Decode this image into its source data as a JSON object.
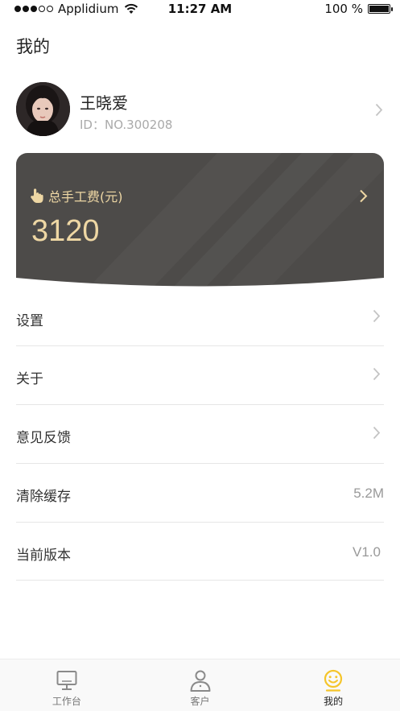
{
  "status_bar": {
    "carrier": "Applidium",
    "time": "11:27 AM",
    "battery": "100 %"
  },
  "page": {
    "title": "我的"
  },
  "profile": {
    "name": "王晓爱",
    "id_text": "ID：NO.300208"
  },
  "fee_card": {
    "label": "总手工费(元)",
    "amount": "3120"
  },
  "menu": {
    "items": [
      {
        "label": "设置"
      },
      {
        "label": "关于"
      },
      {
        "label": "意见反馈"
      },
      {
        "label": "清除缓存",
        "value": "5.2M"
      },
      {
        "label": "当前版本",
        "value": "V1.0"
      }
    ]
  },
  "tab_bar": {
    "tabs": [
      {
        "label": "工作台",
        "icon": "monitor-icon"
      },
      {
        "label": "客户",
        "icon": "user-icon"
      },
      {
        "label": "我的",
        "icon": "smiley-icon",
        "active": true
      }
    ]
  },
  "colors": {
    "accent": "#f5c52a",
    "card_bg": "#4d4b49",
    "card_text": "#eed7a4"
  }
}
